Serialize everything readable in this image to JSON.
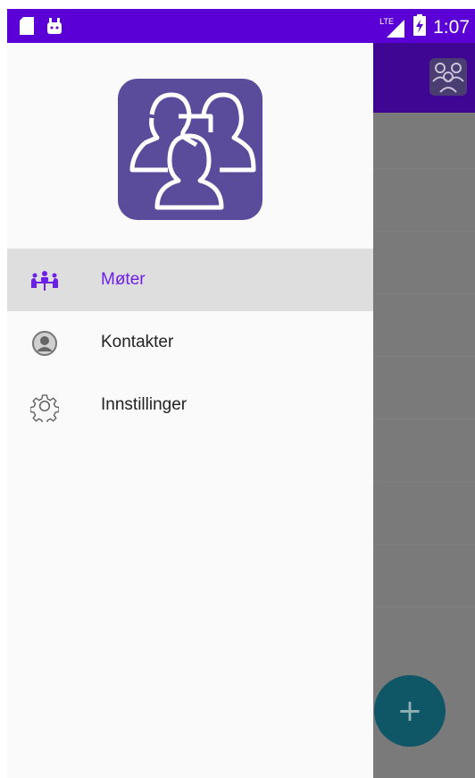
{
  "status_bar": {
    "time": "1:07",
    "network_label": "LTE",
    "left_icons": [
      "sd-card-icon",
      "android-icon"
    ],
    "right_icons": [
      "signal-icon",
      "battery-charging-icon"
    ],
    "bg_color": "#5a00d6"
  },
  "app": {
    "toolbar_color": "#3f0694",
    "toolbar_icon": "meeting-group-icon",
    "fab_label": "+",
    "fab_color": "#0f5766"
  },
  "drawer": {
    "logo_icon": "people-group-logo",
    "logo_color": "#5b4c9b",
    "items": [
      {
        "label": "Møter",
        "icon": "meeting-icon",
        "active": true
      },
      {
        "label": "Kontakter",
        "icon": "contact-icon",
        "active": false
      },
      {
        "label": "Innstillinger",
        "icon": "settings-gear-icon",
        "active": false
      }
    ],
    "accent_color": "#6c1fe6"
  }
}
